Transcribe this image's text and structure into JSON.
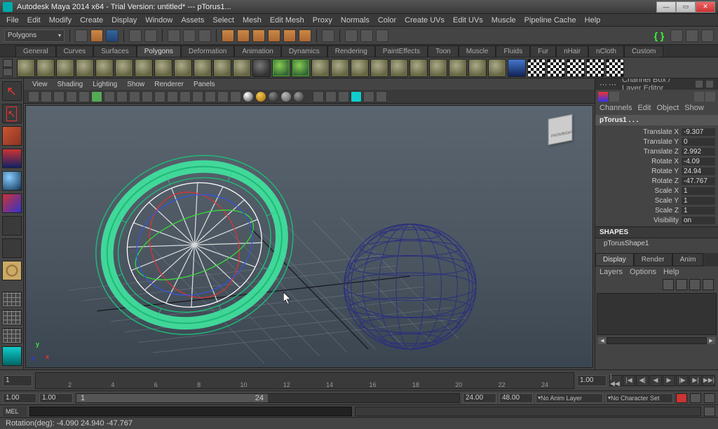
{
  "titlebar": {
    "title": "Autodesk Maya 2014 x64 - Trial Version: untitled*   ---   pTorus1..."
  },
  "menubar": [
    "File",
    "Edit",
    "Modify",
    "Create",
    "Display",
    "Window",
    "Assets",
    "Select",
    "Mesh",
    "Edit Mesh",
    "Proxy",
    "Normals",
    "Color",
    "Create UVs",
    "Edit UVs",
    "Muscle",
    "Pipeline Cache",
    "Help"
  ],
  "mode_selector": "Polygons",
  "shelf_tabs": [
    "General",
    "Curves",
    "Surfaces",
    "Polygons",
    "Deformation",
    "Animation",
    "Dynamics",
    "Rendering",
    "PaintEffects",
    "Toon",
    "Muscle",
    "Fluids",
    "Fur",
    "nHair",
    "nCloth",
    "Custom"
  ],
  "shelf_active_tab": "Polygons",
  "viewport_menus": [
    "View",
    "Shading",
    "Lighting",
    "Show",
    "Renderer",
    "Panels"
  ],
  "viewcube": {
    "front": "FRONT",
    "right": "RIGHT"
  },
  "channel_box": {
    "header": "Channel Box / Layer Editor",
    "submenu": [
      "Channels",
      "Edit",
      "Object",
      "Show"
    ],
    "object": "pTorus1 . . .",
    "attrs": [
      {
        "label": "Translate X",
        "value": "-9.307"
      },
      {
        "label": "Translate Y",
        "value": "0"
      },
      {
        "label": "Translate Z",
        "value": "2.992"
      },
      {
        "label": "Rotate X",
        "value": "-4.09"
      },
      {
        "label": "Rotate Y",
        "value": "24.94"
      },
      {
        "label": "Rotate Z",
        "value": "-47.767"
      },
      {
        "label": "Scale X",
        "value": "1"
      },
      {
        "label": "Scale Y",
        "value": "1"
      },
      {
        "label": "Scale Z",
        "value": "1"
      },
      {
        "label": "Visibility",
        "value": "on"
      }
    ],
    "shapes_label": "SHAPES",
    "shape_node": "pTorusShape1"
  },
  "layers": {
    "tabs": [
      "Display",
      "Render",
      "Anim"
    ],
    "active_tab": "Display",
    "menu": [
      "Layers",
      "Options",
      "Help"
    ]
  },
  "timeline": {
    "current_frame_left": "1",
    "current_frame_right": "1.00",
    "ticks": [
      "2",
      "4",
      "6",
      "8",
      "10",
      "12",
      "14",
      "16",
      "18",
      "20",
      "22",
      "24"
    ]
  },
  "range": {
    "start": "1.00",
    "playback_start": "1.00",
    "handle_start": "1",
    "handle_end": "24",
    "playback_end": "24.00",
    "end": "48.00",
    "anim_layer": "No Anim Layer",
    "char_set": "No Character Set"
  },
  "cmd": {
    "lang": "MEL"
  },
  "status": "Rotation(deg):    -4.090    24.940    -47.767"
}
